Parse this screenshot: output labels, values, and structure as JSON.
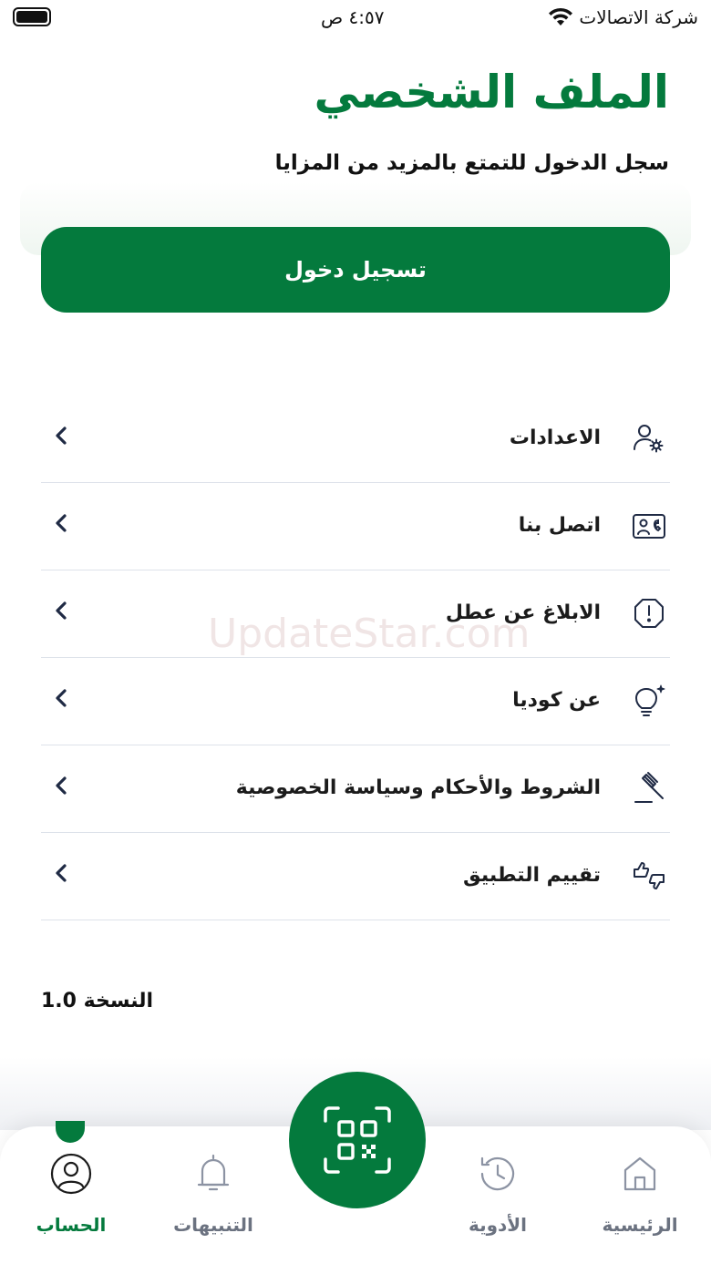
{
  "status_bar": {
    "carrier": "شركة الاتصالات",
    "time": "٤:٥٧ ص",
    "wifi_icon": "wifi-icon",
    "battery_icon": "battery-icon"
  },
  "header": {
    "title": "الملف الشخصي",
    "subtitle": "سجل الدخول للتمتع بالمزيد من المزايا"
  },
  "login_button": {
    "label": "تسجيل دخول"
  },
  "menu": {
    "items": [
      {
        "label": "الاعدادات",
        "icon": "user-settings-icon"
      },
      {
        "label": "اتصل بنا",
        "icon": "contact-card-icon"
      },
      {
        "label": "الابلاغ عن عطل",
        "icon": "alert-octagon-icon"
      },
      {
        "label": "عن كوديا",
        "icon": "lightbulb-sparkle-icon"
      },
      {
        "label": "الشروط والأحكام وسياسة الخصوصية",
        "icon": "gavel-icon"
      },
      {
        "label": "تقييم التطبيق",
        "icon": "thumbs-rating-icon"
      }
    ]
  },
  "watermark": "UpdateStar.com",
  "version": "النسخة 1.0",
  "tab_bar": {
    "tabs": [
      {
        "label": "الرئيسية",
        "icon": "home-icon"
      },
      {
        "label": "الأدوية",
        "icon": "history-icon"
      },
      {
        "label": "التنبيهات",
        "icon": "bell-icon"
      },
      {
        "label": "الحساب",
        "icon": "user-circle-icon",
        "active": true
      }
    ],
    "scan_icon": "qr-scan-icon"
  },
  "colors": {
    "brand_green": "#047a3d",
    "text_dark": "#111111",
    "icon_navy": "#1f2a44",
    "inactive_gray": "#6b7280",
    "divider": "#dde2ea"
  }
}
